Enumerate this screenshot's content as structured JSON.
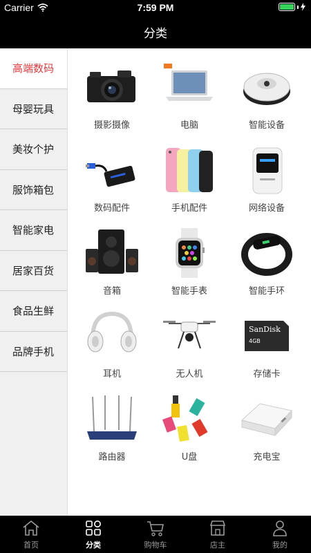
{
  "status": {
    "carrier": "Carrier",
    "time": "7:59 PM"
  },
  "header": {
    "title": "分类"
  },
  "sidebar": {
    "items": [
      {
        "label": "高端数码",
        "active": true
      },
      {
        "label": "母婴玩具"
      },
      {
        "label": "美妆个护"
      },
      {
        "label": "服饰箱包"
      },
      {
        "label": "智能家电"
      },
      {
        "label": "居家百货"
      },
      {
        "label": "食品生鲜"
      },
      {
        "label": "品牌手机"
      }
    ]
  },
  "products": [
    {
      "label": "摄影摄像",
      "icon": "camera-icon"
    },
    {
      "label": "电脑",
      "icon": "laptop-icon"
    },
    {
      "label": "智能设备",
      "icon": "robot-vacuum-icon"
    },
    {
      "label": "数码配件",
      "icon": "card-reader-icon"
    },
    {
      "label": "手机配件",
      "icon": "phone-cases-icon"
    },
    {
      "label": "网络设备",
      "icon": "mifi-icon"
    },
    {
      "label": "音箱",
      "icon": "speaker-icon"
    },
    {
      "label": "智能手表",
      "icon": "smartwatch-icon"
    },
    {
      "label": "智能手环",
      "icon": "fitness-band-icon"
    },
    {
      "label": "耳机",
      "icon": "headphones-icon"
    },
    {
      "label": "无人机",
      "icon": "drone-icon"
    },
    {
      "label": "存储卡",
      "icon": "sd-card-icon",
      "brand": "SanDisk",
      "capacity": "4GB"
    },
    {
      "label": "路由器",
      "icon": "router-icon"
    },
    {
      "label": "U盘",
      "icon": "usb-drive-icon"
    },
    {
      "label": "充电宝",
      "icon": "power-bank-icon"
    }
  ],
  "tabbar": {
    "items": [
      {
        "label": "首页",
        "icon": "home-icon"
      },
      {
        "label": "分类",
        "icon": "category-icon",
        "active": true
      },
      {
        "label": "购物车",
        "icon": "cart-icon"
      },
      {
        "label": "店主",
        "icon": "store-icon"
      },
      {
        "label": "我的",
        "icon": "user-icon"
      }
    ]
  },
  "colors": {
    "accent": "#e8383d",
    "bar_background": "#000000",
    "sidebar_background": "#f0f0f0"
  }
}
